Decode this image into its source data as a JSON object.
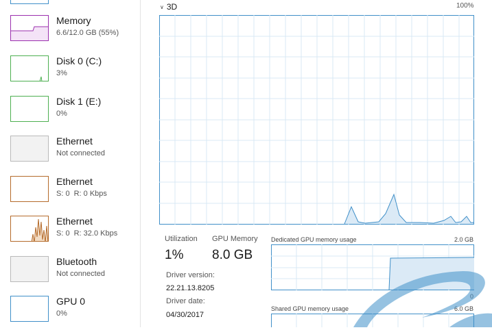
{
  "sidebar": {
    "items": [
      {
        "title": "Memory",
        "subtitle": "6.6/12.0 GB (55%)",
        "color": "#9b2fae"
      },
      {
        "title": "Disk 0 (C:)",
        "subtitle": "3%",
        "color": "#4caf50"
      },
      {
        "title": "Disk 1 (E:)",
        "subtitle": "0%",
        "color": "#4caf50"
      },
      {
        "title": "Ethernet",
        "subtitle": "Not connected",
        "color": "#a0a0a0"
      },
      {
        "title": "Ethernet",
        "send_label": "S:",
        "send_value": "0",
        "recv_label": "R:",
        "recv_value": "0 Kbps",
        "color": "#b46a2a"
      },
      {
        "title": "Ethernet",
        "send_label": "S:",
        "send_value": "0",
        "recv_label": "R:",
        "recv_value": "32.0 Kbps",
        "color": "#b46a2a"
      },
      {
        "title": "Bluetooth",
        "subtitle": "Not connected",
        "color": "#a0a0a0"
      },
      {
        "title": "GPU 0",
        "subtitle": "0%",
        "color": "#3f8fc8"
      }
    ]
  },
  "main": {
    "engine": {
      "label": "3D",
      "max_label": "100%",
      "icon": "chevron-down-icon"
    },
    "utilization": {
      "label": "Utilization",
      "value": "1%"
    },
    "gpu_memory": {
      "label": "GPU Memory",
      "value": "8.0 GB"
    },
    "driver_version": {
      "label": "Driver version:",
      "value": "22.21.13.8205"
    },
    "driver_date": {
      "label": "Driver date:",
      "value": "04/30/2017"
    },
    "dedicated": {
      "label": "Dedicated GPU memory usage",
      "max": "2.0 GB",
      "min": "0"
    },
    "shared": {
      "label": "Shared GPU memory usage",
      "max": "6.0 GB"
    }
  },
  "colors": {
    "gpu_line": "#3f8fc8",
    "gpu_fill": "#dbeaf6",
    "grid": "#d9e8f4",
    "accent": "#3f8fc8"
  }
}
